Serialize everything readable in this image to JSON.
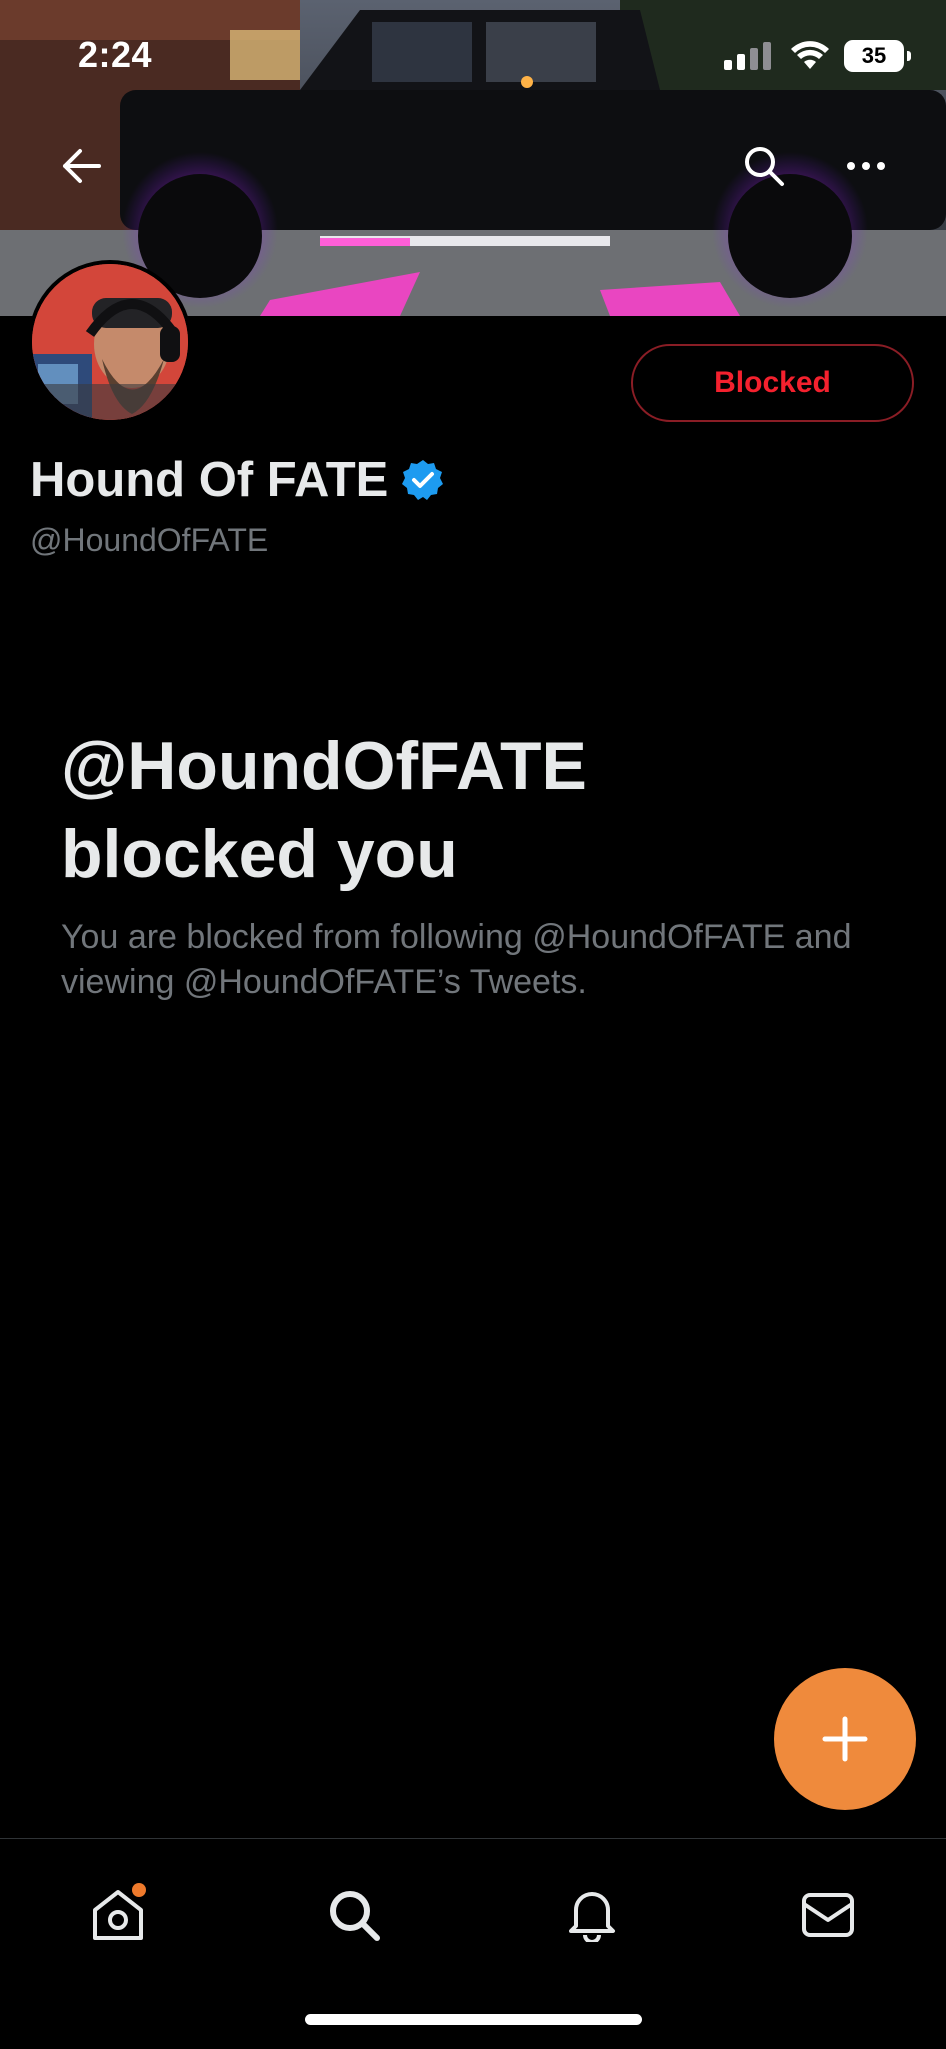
{
  "status_bar": {
    "time": "2:24",
    "battery": "35"
  },
  "profile": {
    "display_name": "Hound Of FATE",
    "handle": "@HoundOfFATE",
    "verified": true,
    "relationship_button": "Blocked"
  },
  "blocked_notice": {
    "title_line1": "@HoundOfFATE",
    "title_line2": "blocked you",
    "description": "You are blocked from following @HoundOfFATE and viewing @HoundOfFATE’s Tweets."
  },
  "tabs": [
    {
      "icon": "home-icon",
      "has_notification_dot": true
    },
    {
      "icon": "search-icon"
    },
    {
      "icon": "bell-icon"
    },
    {
      "icon": "mail-icon"
    }
  ],
  "colors": {
    "background": "#000000",
    "blocked_red": "#f4212e",
    "fab_orange": "#ef8a3c",
    "verified_blue": "#1d9bf0",
    "secondary_text": "#71767b"
  }
}
